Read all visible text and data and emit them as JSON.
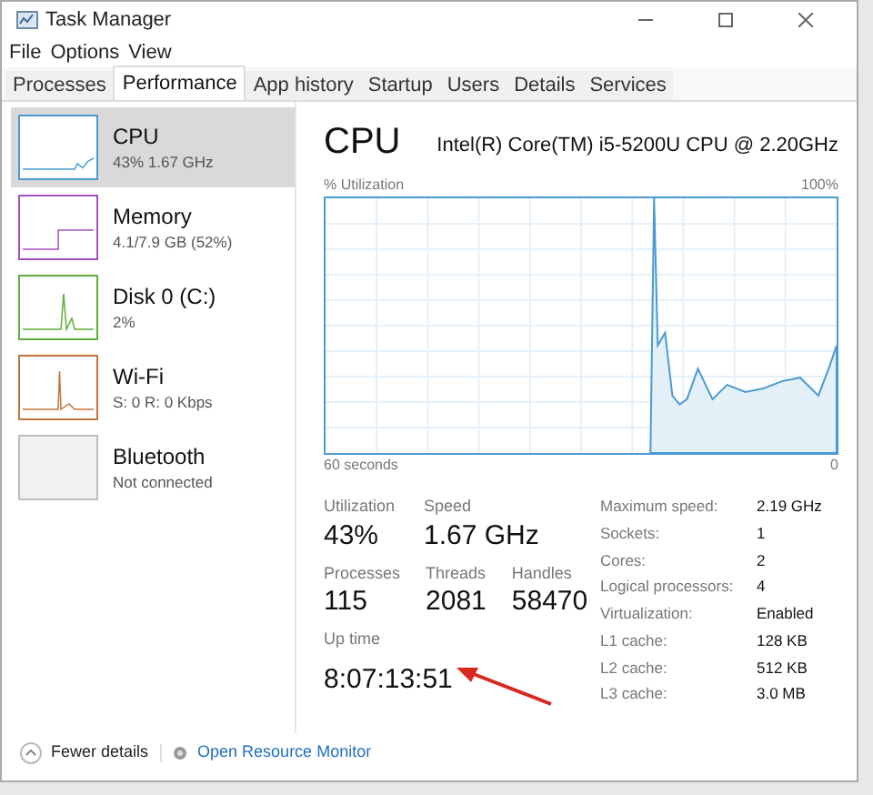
{
  "window": {
    "title": "Task Manager"
  },
  "menu": [
    "File",
    "Options",
    "View"
  ],
  "tabs": [
    {
      "label": "Processes",
      "selected": false
    },
    {
      "label": "Performance",
      "selected": true
    },
    {
      "label": "App history",
      "selected": false
    },
    {
      "label": "Startup",
      "selected": false
    },
    {
      "label": "Users",
      "selected": false
    },
    {
      "label": "Details",
      "selected": false
    },
    {
      "label": "Services",
      "selected": false
    }
  ],
  "sidebar": {
    "items": [
      {
        "name": "CPU",
        "detail": "43% 1.67 GHz",
        "color": "#4a9bd1",
        "selected": true
      },
      {
        "name": "Memory",
        "detail": "4.1/7.9 GB (52%)",
        "color": "#a24fc0",
        "selected": false
      },
      {
        "name": "Disk 0 (C:)",
        "detail": "2%",
        "color": "#5fae3a",
        "selected": false
      },
      {
        "name": "Wi-Fi",
        "detail": "S: 0 R: 0 Kbps",
        "color": "#c2743a",
        "selected": false
      },
      {
        "name": "Bluetooth",
        "detail": "Not connected",
        "color": "#bdbdbd",
        "selected": false
      }
    ]
  },
  "main": {
    "title": "CPU",
    "model": "Intel(R) Core(TM) i5-5200U CPU @ 2.20GHz",
    "graph_label": "% Utilization",
    "graph_max": "100%",
    "graph_time": "60 seconds",
    "graph_min": "0",
    "stats": [
      {
        "label": "Utilization",
        "value": "43%"
      },
      {
        "label": "Speed",
        "value": "1.67 GHz"
      },
      {
        "label": "Processes",
        "value": "115"
      },
      {
        "label": "Threads",
        "value": "2081"
      },
      {
        "label": "Handles",
        "value": "58470"
      },
      {
        "label": "Up time",
        "value": "8:07:13:51"
      }
    ],
    "specs": [
      {
        "label": "Maximum speed:",
        "value": "2.19 GHz"
      },
      {
        "label": "Sockets:",
        "value": "1"
      },
      {
        "label": "Cores:",
        "value": "2"
      },
      {
        "label": "Logical processors:",
        "value": "4"
      },
      {
        "label": "Virtualization:",
        "value": "Enabled"
      },
      {
        "label": "L1 cache:",
        "value": "128 KB"
      },
      {
        "label": "L2 cache:",
        "value": "512 KB"
      },
      {
        "label": "L3 cache:",
        "value": "3.0 MB"
      }
    ]
  },
  "footer": {
    "fewer_details": "Fewer details",
    "link": "Open Resource Monitor"
  }
}
